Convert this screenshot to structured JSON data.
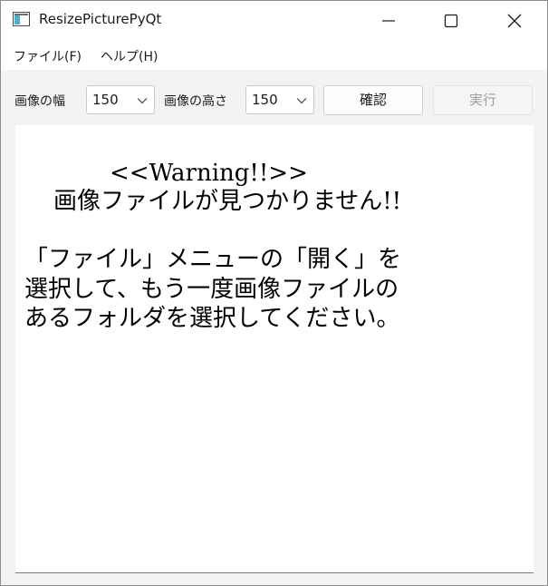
{
  "window": {
    "title": "ResizePicturePyQt"
  },
  "menubar": {
    "file": "ファイル(F)",
    "help": "ヘルプ(H)"
  },
  "toolbar": {
    "width_label": "画像の幅",
    "width_value": "150",
    "height_label": "画像の高さ",
    "height_value": "150",
    "confirm_label": "確認",
    "run_label": "実行"
  },
  "message": {
    "warning": "<<Warning!!>>",
    "not_found": "画像ファイルが見つかりません!!",
    "line1": "「ファイル」メニューの「開く」を",
    "line2": "選択して、もう一度画像ファイルの",
    "line3": "あるフォルダを選択してください。"
  },
  "icons": {
    "app": "app-window-icon",
    "minimize": "minimize-icon",
    "maximize": "maximize-icon",
    "close": "close-icon",
    "dropdown": "chevron-down-icon"
  }
}
